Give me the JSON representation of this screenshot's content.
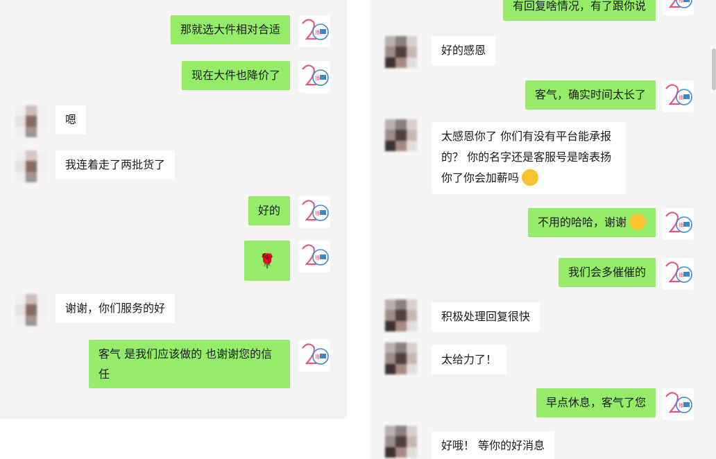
{
  "left_chat": {
    "messages": [
      {
        "from": "me",
        "text": "那就选大件相对合适"
      },
      {
        "from": "me",
        "text": "现在大件也降价了"
      },
      {
        "from": "other",
        "text": "嗯"
      },
      {
        "from": "other",
        "text": "我连着走了两批货了"
      },
      {
        "from": "me",
        "text": "好的"
      },
      {
        "from": "me",
        "text": "🌹"
      },
      {
        "from": "other",
        "text": "谢谢，你们服务的好"
      },
      {
        "from": "me",
        "text": "客气  是我们应该做的  也谢谢您的信任"
      }
    ]
  },
  "right_chat": {
    "messages": [
      {
        "from": "me",
        "text": "有回复啥情况，有了跟你说"
      },
      {
        "from": "other",
        "text": "好的感恩"
      },
      {
        "from": "me",
        "text": "客气，确实时间太长了"
      },
      {
        "from": "other",
        "text": "太感恩你了  你们有没有平台能承报的？  你的名字还是客服号是啥表扬你了你会加薪吗"
      },
      {
        "from": "me",
        "text": "不用的哈哈，谢谢"
      },
      {
        "from": "me",
        "text": "我们会多催催的"
      },
      {
        "from": "other",
        "text": "积极处理回复很快"
      },
      {
        "from": "other",
        "text": "太给力了！"
      },
      {
        "from": "me",
        "text": "早点休息，客气了您"
      },
      {
        "from": "other",
        "text": "好哦！  等你的好消息"
      }
    ]
  },
  "icons": {
    "my_avatar": "company-logo-avatar",
    "other_avatar": "blurred-user-avatar",
    "thinking_emoji": "thinking-face-icon",
    "wink_emoji": "winking-tongue-face-icon"
  },
  "colors": {
    "my_bubble": "#95ec69",
    "other_bubble": "#ffffff",
    "chat_background": "#f5f5f5"
  }
}
